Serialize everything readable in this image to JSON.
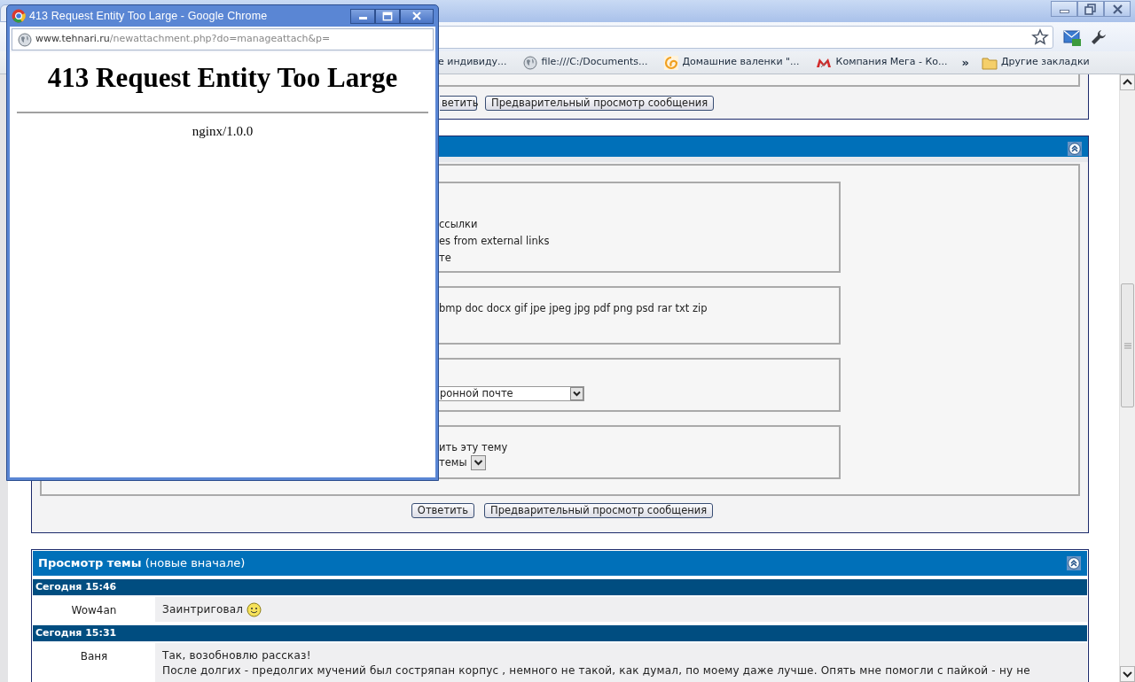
{
  "browser": {
    "bookmarks": [
      {
        "label": "е индивиду...",
        "kind": "none"
      },
      {
        "label": "file:///C:/Documents...",
        "kind": "globe"
      },
      {
        "label": "Домашние валенки \"...",
        "kind": "swirl"
      },
      {
        "label": "Компания Мега - Ко...",
        "kind": "letter-m"
      }
    ],
    "more": "»",
    "other_bookmarks": "Другие закладки"
  },
  "page": {
    "top_section": {
      "buttons": [
        "ветить",
        "Предварительный просмотр сообщения"
      ]
    },
    "options_section": {
      "fieldsets": [
        {
          "kind": "lines",
          "lines": [
            "ссылки",
            "es from external links",
            "те"
          ]
        },
        {
          "kind": "lines",
          "lines": [
            "bmp doc docx gif jpe jpeg jpg pdf png psd rar txt zip"
          ]
        },
        {
          "kind": "select",
          "value": "ронной почте"
        },
        {
          "kind": "label_select",
          "label": "ить эту тему",
          "value": "темы"
        }
      ],
      "buttons": [
        "Ответить",
        "Предварительный просмотр сообщения"
      ]
    },
    "thread": {
      "title": "Просмотр темы",
      "subtitle": "(новые вначале)",
      "posts": [
        {
          "date": "Сегодня 15:46",
          "author": "Wow4an",
          "lines": [
            "Заинтриговал"
          ],
          "smiley": true
        },
        {
          "date": "Сегодня 15:31",
          "author": "Ваня",
          "lines": [
            "Так, возобновлю рассказ!",
            "После долгих - предолгих мучений был состряпан корпус , немного не такой, как думал, по моему даже лучше. Опять мне помогли с пайкой - ну не"
          ],
          "smiley": false
        }
      ]
    }
  },
  "popup": {
    "title": "413 Request Entity Too Large - Google Chrome",
    "url_host": "www.tehnari.ru",
    "url_path": "/newattachment.php?do=manageattach&p=",
    "heading": "413 Request Entity Too Large",
    "server": "nginx/1.0.0"
  }
}
